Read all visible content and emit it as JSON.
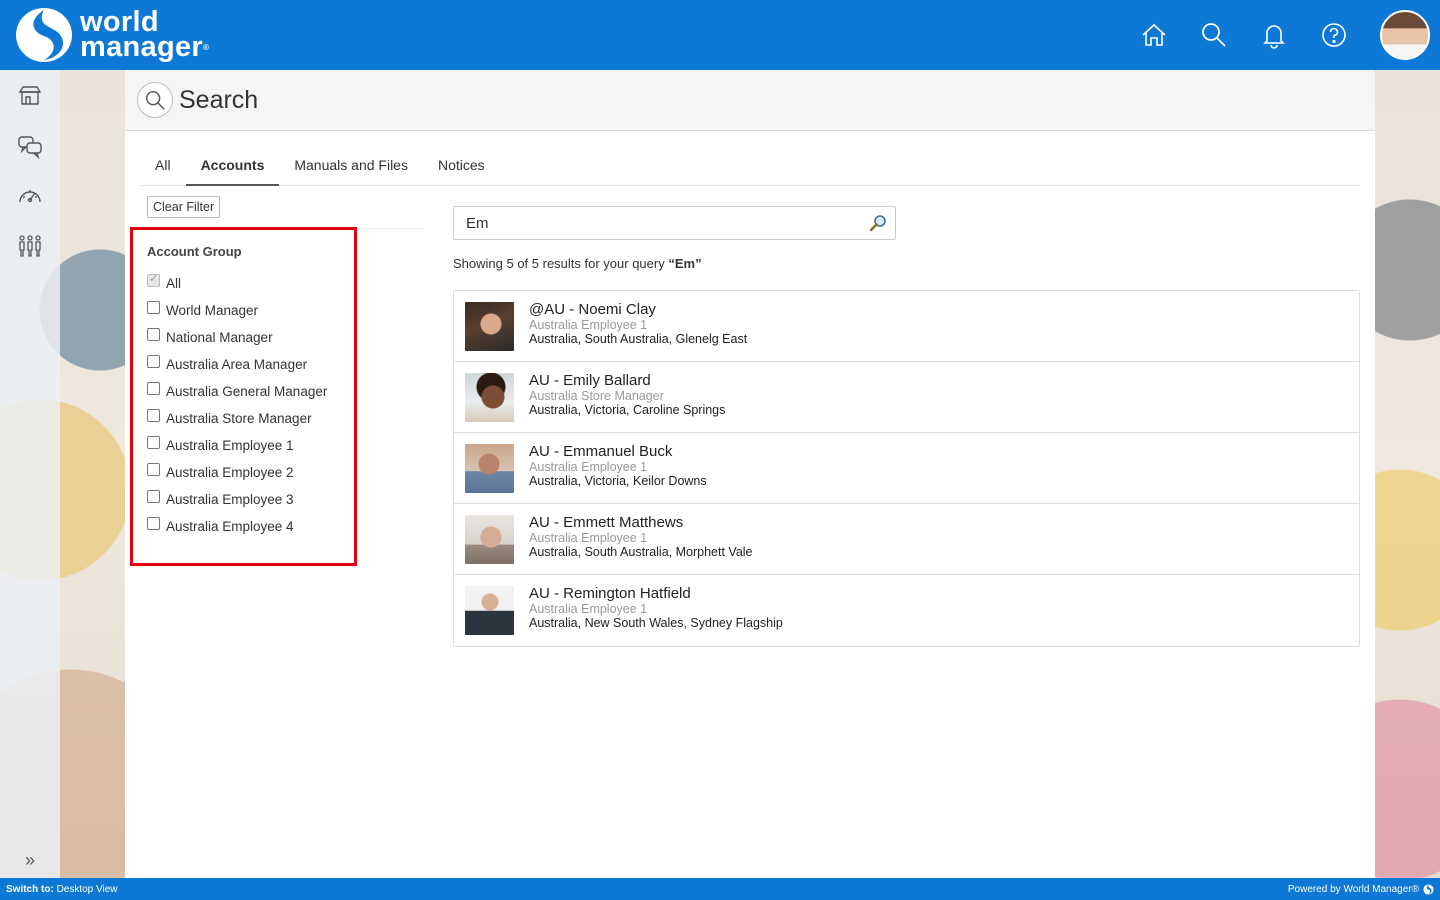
{
  "brand": {
    "line1": "world",
    "line2": "manager",
    "registered": "®",
    "color": "#0d78d6"
  },
  "header_icons": [
    "home-icon",
    "search-icon",
    "bell-icon",
    "help-icon"
  ],
  "page": {
    "title": "Search"
  },
  "tabs": [
    {
      "label": "All",
      "active": false
    },
    {
      "label": "Accounts",
      "active": true
    },
    {
      "label": "Manuals and Files",
      "active": false
    },
    {
      "label": "Notices",
      "active": false
    }
  ],
  "filter": {
    "clear_label": "Clear Filter",
    "title": "Account Group",
    "items": [
      {
        "label": "All",
        "checked": true
      },
      {
        "label": "World Manager",
        "checked": false
      },
      {
        "label": "National Manager",
        "checked": false
      },
      {
        "label": "Australia Area Manager",
        "checked": false
      },
      {
        "label": "Australia General Manager",
        "checked": false
      },
      {
        "label": "Australia Store Manager",
        "checked": false
      },
      {
        "label": "Australia Employee 1",
        "checked": false
      },
      {
        "label": "Australia Employee 2",
        "checked": false
      },
      {
        "label": "Australia Employee 3",
        "checked": false
      },
      {
        "label": "Australia Employee 4",
        "checked": false
      }
    ],
    "highlight_color": "#e60012"
  },
  "search": {
    "value": "Em",
    "results_prefix": "Showing 5 of 5 results for your query ",
    "results_query": "“Em”"
  },
  "results": [
    {
      "name": "@AU - Noemi Clay",
      "role": "Australia Employee 1",
      "location": "Australia, South Australia, Glenelg East"
    },
    {
      "name": "AU - Emily Ballard",
      "role": "Australia Store Manager",
      "location": "Australia, Victoria, Caroline Springs"
    },
    {
      "name": "AU - Emmanuel Buck",
      "role": "Australia Employee 1",
      "location": "Australia, Victoria, Keilor Downs"
    },
    {
      "name": "AU - Emmett Matthews",
      "role": "Australia Employee 1",
      "location": "Australia, South Australia, Morphett Vale"
    },
    {
      "name": "AU - Remington Hatfield",
      "role": "Australia Employee 1",
      "location": "Australia, New South Wales, Sydney Flagship"
    }
  ],
  "footer": {
    "switch_label": "Switch to:",
    "switch_value": "Desktop View",
    "powered": "Powered by World Manager®"
  }
}
